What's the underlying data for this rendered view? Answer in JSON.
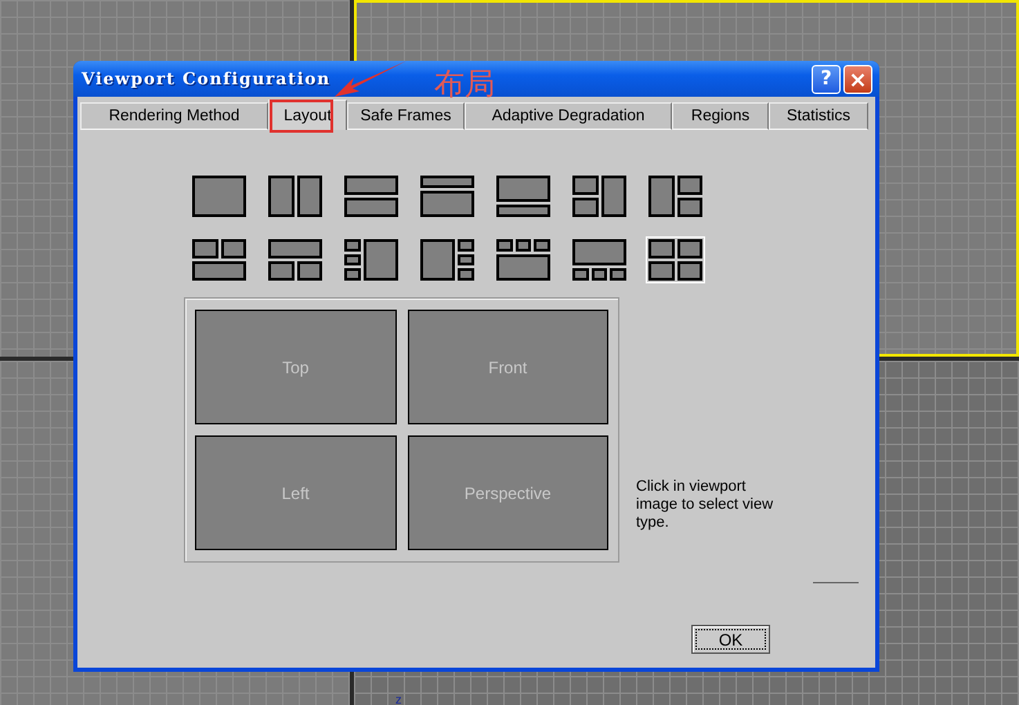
{
  "viewports": [
    {
      "active": false
    },
    {
      "active": true
    },
    {
      "active": false
    },
    {
      "active": false,
      "axis_label": "z"
    }
  ],
  "window": {
    "title": "Viewport Configuration",
    "help_button": "?",
    "close_button": "×"
  },
  "tabs": [
    {
      "label": "Rendering Method",
      "selected": false
    },
    {
      "label": "Layout",
      "selected": true
    },
    {
      "label": "Safe Frames",
      "selected": false
    },
    {
      "label": "Adaptive Degradation",
      "selected": false
    },
    {
      "label": "Regions",
      "selected": false
    },
    {
      "label": "Statistics",
      "selected": false
    }
  ],
  "annotation": {
    "text": "布局"
  },
  "layouts": [
    {
      "kind": "single",
      "selected": false
    },
    {
      "kind": "two-columns",
      "selected": false
    },
    {
      "kind": "two-rows",
      "selected": false
    },
    {
      "kind": "top-small",
      "selected": false
    },
    {
      "kind": "bottom-small",
      "selected": false
    },
    {
      "kind": "left-two",
      "selected": false
    },
    {
      "kind": "right-two",
      "selected": false
    },
    {
      "kind": "top-two",
      "selected": false
    },
    {
      "kind": "bottom-two",
      "selected": false
    },
    {
      "kind": "left-three",
      "selected": false
    },
    {
      "kind": "right-three",
      "selected": false
    },
    {
      "kind": "top-three",
      "selected": false
    },
    {
      "kind": "bottom-three",
      "selected": false
    },
    {
      "kind": "quad",
      "selected": true
    }
  ],
  "preview_panes": [
    "Top",
    "Front",
    "Left",
    "Perspective"
  ],
  "hint": "Click in viewport image to select view type.",
  "buttons": [
    "OK"
  ]
}
